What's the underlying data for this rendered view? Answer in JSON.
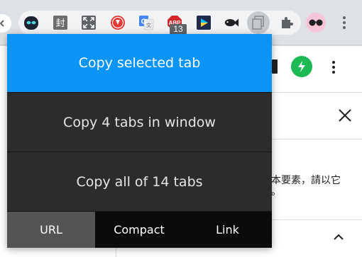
{
  "toolbar": {
    "extension_badge": "13",
    "extensions": [
      {
        "icon": "ghost-mask-icon"
      },
      {
        "icon": "seal-icon",
        "text": "封"
      },
      {
        "icon": "fullscreen-icon"
      },
      {
        "icon": "red-download-icon"
      },
      {
        "icon": "google-translate-icon"
      },
      {
        "icon": "adblock-icon",
        "text": "ABP"
      },
      {
        "icon": "play-store-icon"
      },
      {
        "icon": "fish-icon"
      },
      {
        "icon": "copy-tabs-icon"
      },
      {
        "icon": "puzzle-icon"
      }
    ]
  },
  "popup": {
    "copy_selected_label": "Copy selected tab",
    "copy_window_label": "Copy 4 tabs in window",
    "copy_all_label": "Copy all of 14 tabs",
    "formats": [
      {
        "label": "URL",
        "selected": true
      },
      {
        "label": "Compact",
        "selected": false
      },
      {
        "label": "Link",
        "selected": false
      }
    ],
    "colors": {
      "selected_action": "#0a94f6",
      "panel": "#2c2c2c",
      "selected_format": "#545454"
    }
  },
  "page": {
    "text_line1": "本要素，請以它",
    "text_line2": "。"
  }
}
